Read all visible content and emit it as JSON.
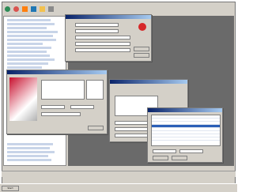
{
  "app": {
    "taskbar": {
      "start_label": "Start",
      "clock": ""
    },
    "toolbar": {
      "icons": [
        "globe-icon",
        "user-icon",
        "chart-icon",
        "tools-icon",
        "folder-icon",
        "arrow-icon"
      ]
    }
  },
  "dialogs": {
    "properties": {
      "title": ""
    },
    "wizard": {
      "title": ""
    },
    "settings": {
      "title": ""
    },
    "table": {
      "title": ""
    }
  },
  "colors": {
    "desktop": "#6a6a6a",
    "titlebar": "#0a246a",
    "dialog_bg": "#d4d0c8",
    "selection": "#2b5fb7",
    "logo_red": "#c8102e"
  }
}
